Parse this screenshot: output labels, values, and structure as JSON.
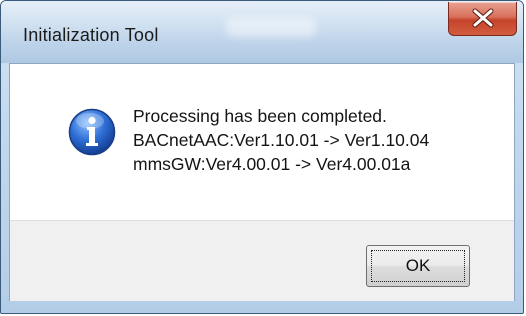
{
  "window": {
    "title": "Initialization Tool",
    "close_icon": "close-icon"
  },
  "dialog": {
    "icon": "information-icon",
    "message_lines": [
      "Processing has been completed.",
      "BACnetAAC:Ver1.10.01 -> Ver1.10.04",
      "mmsGW:Ver4.00.01 -> Ver4.00.01a"
    ],
    "ok_label": "OK"
  },
  "colors": {
    "close_button": "#c5442b",
    "info_icon": "#2b63c6",
    "titlebar": "#bfd4ea"
  }
}
